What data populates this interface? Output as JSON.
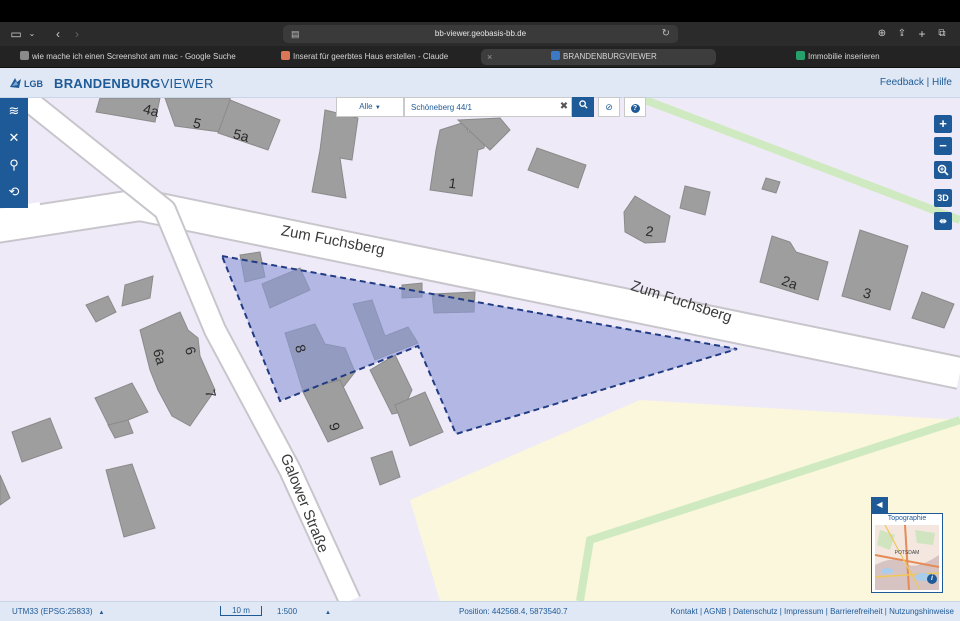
{
  "browser": {
    "url": "bb-viewer.geobasis-bb.de",
    "tabs": [
      {
        "label": "wie mache ich einen Screenshot am mac - Google Suche",
        "color": "#8a8a8a"
      },
      {
        "label": "Inserat für geerbtes Haus erstellen - Claude",
        "color": "#d97757"
      },
      {
        "label": "BRANDENBURGVIEWER",
        "color": "#3b79c4"
      },
      {
        "label": "Immobilie inserieren",
        "color": "#25a06b"
      }
    ]
  },
  "app": {
    "logo": "LGB",
    "title_bold": "BRANDENBURG",
    "title_light": "VIEWER",
    "header_links": "Feedback | Hilfe"
  },
  "search": {
    "filter": "Alle",
    "query": "Schöneberg 44/1"
  },
  "map": {
    "streets": [
      "Zum Fuchsberg",
      "Zum Fuchsberg",
      "Galower Straße"
    ],
    "house_numbers": [
      "4a",
      "5",
      "5a",
      "1",
      "2",
      "2a",
      "3",
      "6",
      "6a",
      "7",
      "8",
      "9"
    ]
  },
  "controls": {
    "three_d": "3D"
  },
  "overview": {
    "title": "Topographie",
    "place": "POTSDAM"
  },
  "status": {
    "crs": "UTM33 (EPSG:25833)",
    "scale_length": "10 m",
    "scale": "1:500",
    "position": "Position: 442568.4, 5873540.7",
    "footer_links": "Kontakt | AGNB | Datenschutz | Impressum | Barrierefreiheit | Nutzungshinweise"
  },
  "colors": {
    "accent": "#1f5a98",
    "map_background": "#efeaf7",
    "building": "#9e9e9e",
    "parcel_fill": "#8d99d6",
    "parcel_stroke": "#213b84"
  }
}
